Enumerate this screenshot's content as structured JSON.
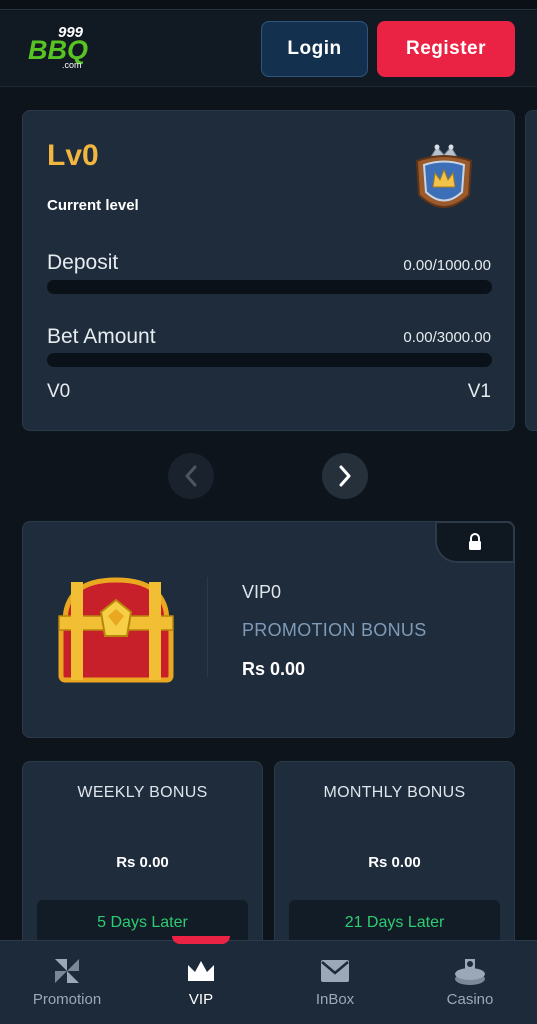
{
  "header": {
    "logo_text": "999 BBQ .com",
    "login_label": "Login",
    "register_label": "Register"
  },
  "level_card": {
    "level": "Lv0",
    "subtitle": "Current level",
    "deposit": {
      "label": "Deposit",
      "value": "0.00/1000.00",
      "progress": 0
    },
    "bet": {
      "label": "Bet Amount",
      "value": "0.00/3000.00",
      "progress": 0
    },
    "from_level": "V0",
    "to_level": "V1",
    "badge_icon": "crown-shield-icon"
  },
  "carousel": {
    "prev_icon": "chevron-left-icon",
    "next_icon": "chevron-right-icon"
  },
  "promo_card": {
    "vip_label": "VIP0",
    "title": "PROMOTION BONUS",
    "amount": "Rs 0.00",
    "lock_icon": "lock-icon",
    "chest_icon": "treasure-chest-icon"
  },
  "bonus_cards": [
    {
      "title": "WEEKLY BONUS",
      "amount": "Rs 0.00",
      "status": "5 Days Later"
    },
    {
      "title": "MONTHLY BONUS",
      "amount": "Rs 0.00",
      "status": "21 Days Later"
    }
  ],
  "bottom_nav": [
    {
      "label": "Promotion",
      "icon": "pinwheel-icon",
      "active": false
    },
    {
      "label": "VIP",
      "icon": "crown-icon",
      "active": true
    },
    {
      "label": "InBox",
      "icon": "envelope-icon",
      "active": false
    },
    {
      "label": "Casino",
      "icon": "casino-chip-icon",
      "active": false
    }
  ],
  "colors": {
    "accent_gold": "#f2b640",
    "register_red": "#ea2244",
    "login_blue": "#14304f",
    "status_green": "#2ecc71",
    "card_bg": "#1e2c3b",
    "page_bg": "#0e141b"
  }
}
